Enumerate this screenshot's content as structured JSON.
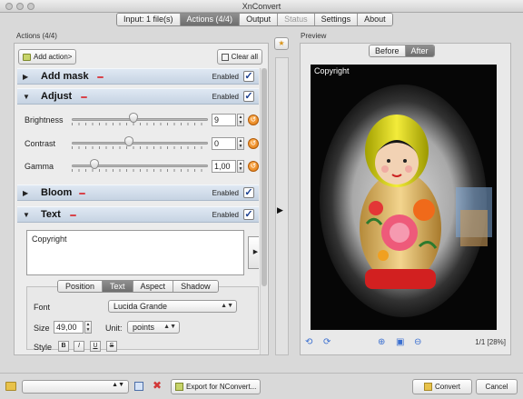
{
  "window": {
    "title": "XnConvert"
  },
  "tabs": [
    {
      "label": "Input: 1 file(s)",
      "state": "normal"
    },
    {
      "label": "Actions (4/4)",
      "state": "active"
    },
    {
      "label": "Output",
      "state": "normal"
    },
    {
      "label": "Status",
      "state": "disabled"
    },
    {
      "label": "Settings",
      "state": "normal"
    },
    {
      "label": "About",
      "state": "normal"
    }
  ],
  "actions_panel": {
    "header": "Actions (4/4)",
    "add_action_label": "Add action>",
    "clear_all_label": "Clear all",
    "enabled_label": "Enabled",
    "check_mark": "✓",
    "items": [
      {
        "title": "Add mask",
        "expanded": false,
        "enabled": true
      },
      {
        "title": "Adjust",
        "expanded": true,
        "enabled": true
      },
      {
        "title": "Bloom",
        "expanded": false,
        "enabled": true
      },
      {
        "title": "Text",
        "expanded": true,
        "enabled": true
      }
    ],
    "adjust": {
      "brightness": {
        "label": "Brightness",
        "value": "9"
      },
      "contrast": {
        "label": "Contrast",
        "value": "0"
      },
      "gamma": {
        "label": "Gamma",
        "value": "1,00"
      }
    },
    "text_action": {
      "text_value": "Copyright",
      "subtabs": [
        "Position",
        "Text",
        "Aspect",
        "Shadow"
      ],
      "active_subtab": "Text",
      "font_label": "Font",
      "font_value": "Lucida Grande",
      "size_label": "Size",
      "size_value": "49,00",
      "unit_label": "Unit:",
      "unit_value": "points",
      "style_label": "Style",
      "style_buttons": [
        "B",
        "I",
        "U",
        "S"
      ]
    }
  },
  "preview": {
    "header": "Preview",
    "before_label": "Before",
    "after_label": "After",
    "active": "After",
    "caption": "Copyright",
    "page_zoom": "1/1 [28%]"
  },
  "bottom": {
    "export_label": "Export for NConvert...",
    "convert_label": "Convert",
    "cancel_label": "Cancel"
  },
  "colors": {
    "accent_tab": "#7a7a7a",
    "action_header": "#d3ddea",
    "remove": "#d8434a",
    "reset": "#e88a1a"
  }
}
